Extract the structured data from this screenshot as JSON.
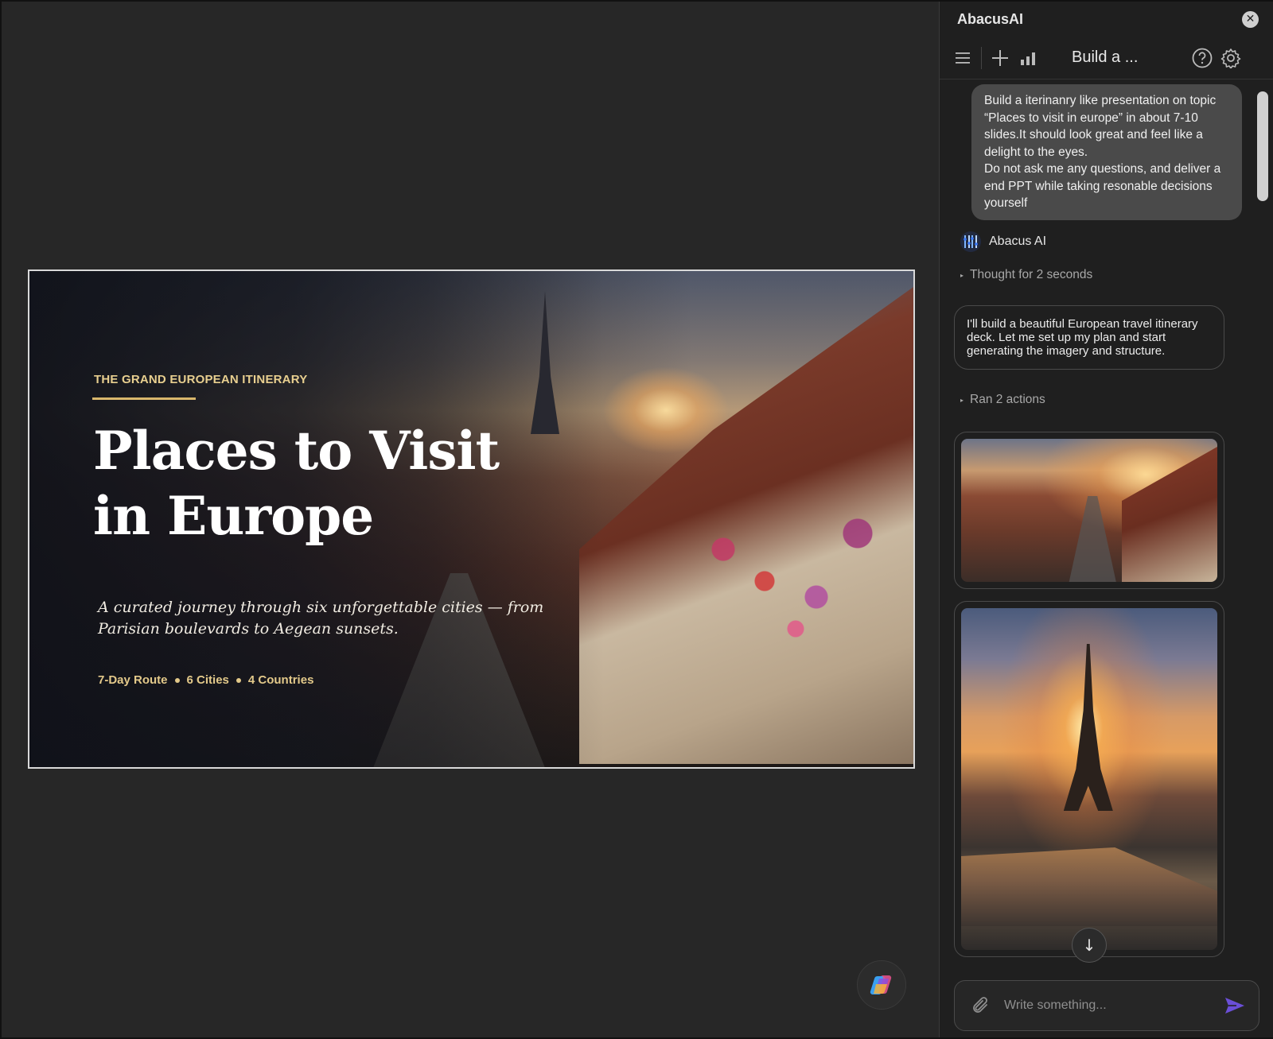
{
  "slide": {
    "eyebrow": "THE GRAND EUROPEAN ITINERARY",
    "title_line1": "Places to Visit",
    "title_line2": "in Europe",
    "subtitle": "A curated journey through six unforgettable cities — from Parisian boulevards to Aegean sunsets.",
    "meta": [
      "7-Day Route",
      "6 Cities",
      "4 Countries"
    ],
    "accent_color": "#e3c98a"
  },
  "panel": {
    "title": "AbacusAI",
    "conversation_title": "Build a ...",
    "icons": {
      "close": "close-icon",
      "menu": "hamburger-menu-icon",
      "new_chat": "plus-icon",
      "stats": "bar-chart-icon",
      "help": "help-circle-icon",
      "settings": "gear-icon"
    }
  },
  "chat": {
    "user_message": "Build a iterinanry like presentation on topic “Places to visit in europe” in about 7-10 slides.It should look great and feel like a delight to the eyes.\nDo not ask me any questions, and deliver a end PPT while taking resonable decisions yourself",
    "assistant_name": "Abacus AI",
    "thought_label": "Thought for 2 seconds",
    "assistant_message": "I'll build a beautiful European travel itinerary deck. Let me set up my plan and start generating the imagery and structure.",
    "actions_label": "Ran 2 actions"
  },
  "composer": {
    "placeholder": "Write something...",
    "send_color": "#6b4fd8"
  }
}
